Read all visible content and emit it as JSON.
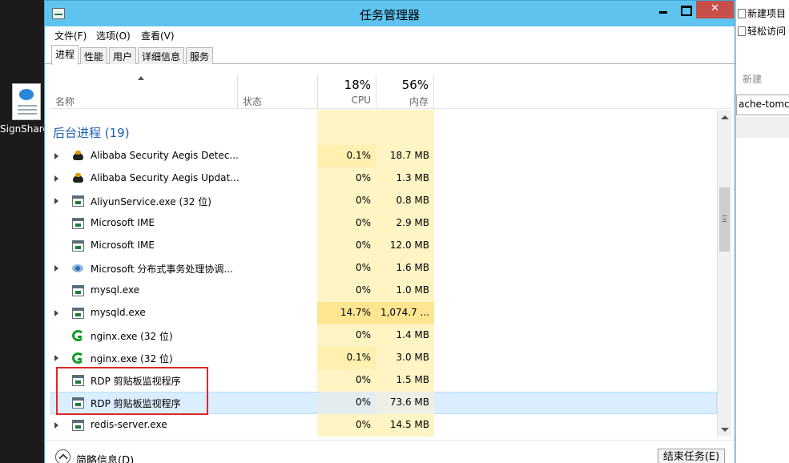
{
  "desktop": {
    "icon_label": "SignShare"
  },
  "explorer": {
    "new_item": "新建项目",
    "easy_access": "轻松访问",
    "new_group": "新建",
    "path_text": "ache-tomcat"
  },
  "window": {
    "title": "任务管理器",
    "close_glyph": "✕"
  },
  "menu": {
    "file": "文件(F)",
    "options": "选项(O)",
    "view": "查看(V)"
  },
  "tabs": [
    "进程",
    "性能",
    "用户",
    "详细信息",
    "服务"
  ],
  "columns": {
    "name": "名称",
    "status": "状态",
    "cpu_percent": "18%",
    "cpu_label": "CPU",
    "mem_percent": "56%",
    "mem_label": "内存"
  },
  "group": {
    "label": "后台进程 (19)"
  },
  "processes": [
    {
      "name": "Alibaba Security Aegis Detec...",
      "cpu": "0.1%",
      "mem": "18.7 MB",
      "icon": "aegis-icon",
      "expandable": true
    },
    {
      "name": "Alibaba Security Aegis Updat...",
      "cpu": "0%",
      "mem": "1.3 MB",
      "icon": "aegis-icon",
      "expandable": true
    },
    {
      "name": "AliyunService.exe (32 位)",
      "cpu": "0%",
      "mem": "0.8 MB",
      "icon": "app-window-icon",
      "expandable": true
    },
    {
      "name": "Microsoft IME",
      "cpu": "0%",
      "mem": "2.9 MB",
      "icon": "app-window-icon",
      "expandable": false
    },
    {
      "name": "Microsoft IME",
      "cpu": "0%",
      "mem": "12.0 MB",
      "icon": "app-window-icon",
      "expandable": false
    },
    {
      "name": "Microsoft 分布式事务处理协调...",
      "cpu": "0%",
      "mem": "1.6 MB",
      "icon": "dtc-icon",
      "expandable": true
    },
    {
      "name": "mysql.exe",
      "cpu": "0%",
      "mem": "1.0 MB",
      "icon": "app-window-icon",
      "expandable": false
    },
    {
      "name": "mysqld.exe",
      "cpu": "14.7%",
      "mem": "1,074.7 ...",
      "icon": "app-window-icon",
      "expandable": true
    },
    {
      "name": "nginx.exe (32 位)",
      "cpu": "0%",
      "mem": "1.4 MB",
      "icon": "nginx-icon",
      "expandable": false
    },
    {
      "name": "nginx.exe (32 位)",
      "cpu": "0.1%",
      "mem": "3.0 MB",
      "icon": "nginx-icon",
      "expandable": true
    },
    {
      "name": "RDP 剪贴板监视程序",
      "cpu": "0%",
      "mem": "1.5 MB",
      "icon": "app-window-icon",
      "expandable": false
    },
    {
      "name": "RDP 剪贴板监视程序",
      "cpu": "0%",
      "mem": "73.6 MB",
      "icon": "app-window-icon",
      "expandable": false,
      "selected": true
    },
    {
      "name": "redis-server.exe",
      "cpu": "0%",
      "mem": "14.5 MB",
      "icon": "app-window-icon",
      "expandable": true
    }
  ],
  "footer": {
    "fewer_details": "简略信息(D)",
    "end_task": "结束任务(E)"
  },
  "colors": {
    "titlebar": "#5ec3ee",
    "heat_light": "#fff4c4",
    "heat_medium": "#fde592",
    "group_label": "#1e5fb5",
    "selection": "#cce8ff",
    "annotation": "#e0262b"
  }
}
